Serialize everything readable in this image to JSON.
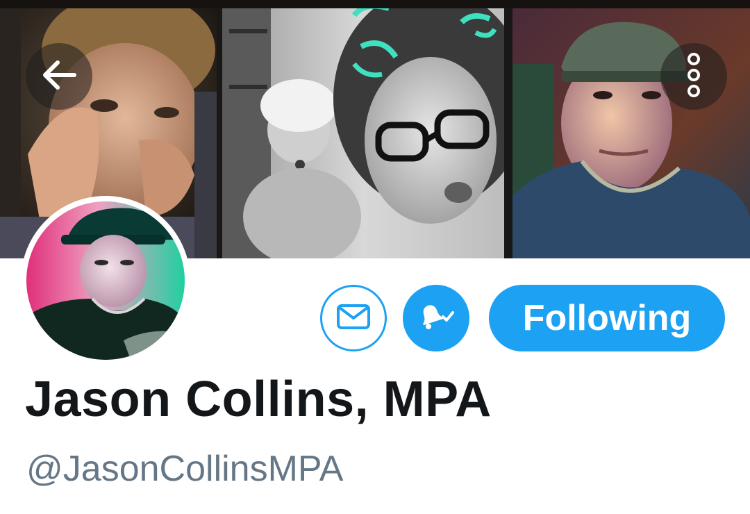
{
  "profile": {
    "display_name": "Jason Collins, MPA",
    "handle": "@JasonCollinsMPA"
  },
  "actions": {
    "following_label": "Following"
  },
  "icons": {
    "back": "arrow-left-icon",
    "more": "more-vertical-icon",
    "message": "envelope-icon",
    "notifications": "bell-check-icon"
  },
  "colors": {
    "accent": "#1da1f2",
    "name_text": "#14171a",
    "handle_text": "#657786"
  }
}
